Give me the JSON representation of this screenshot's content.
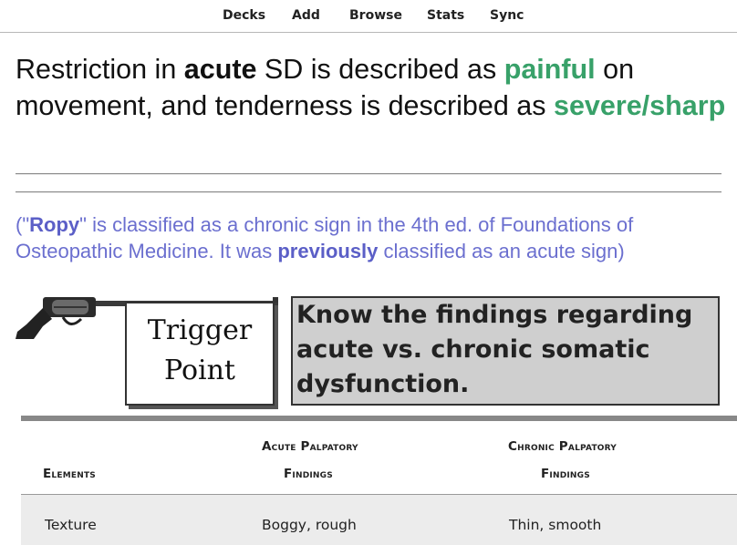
{
  "nav": {
    "items": [
      "Decks",
      "Add",
      "Browse",
      "Stats",
      "Sync"
    ]
  },
  "card": {
    "question": {
      "p1": "Restriction in ",
      "p2": "acute",
      "p3": " SD is described as ",
      "p4": "painful",
      "p5": " on movement, and tenderness is described as ",
      "p6": "severe/sharp"
    },
    "note": {
      "p1": "(\"",
      "p2": "Ropy",
      "p3": "\" is classified as a chronic sign in the 4th ed. of Foundations of Osteopathic Medicine. It was ",
      "p4": "previously",
      "p5": " classified as an acute sign)"
    },
    "image": {
      "sign_line1": "Trigger",
      "sign_line2": "Point",
      "banner_line1": "Know the findings regarding",
      "banner_line2": "acute vs. chronic somatic",
      "banner_line3": "dysfunction.",
      "table": {
        "headers": {
          "elements": "Elements",
          "acute_line1": "Acute Palpatory",
          "acute_line2": "Findings",
          "chronic_line1": "Chronic Palpatory",
          "chronic_line2": "Findings"
        },
        "rows": [
          {
            "element": "Texture",
            "acute": "Boggy, rough",
            "chronic": "Thin, smooth"
          }
        ]
      }
    }
  },
  "colors": {
    "answer_green": "#38a169",
    "note_purple": "#6b6fcf"
  },
  "icons": [
    "revolver-icon"
  ]
}
